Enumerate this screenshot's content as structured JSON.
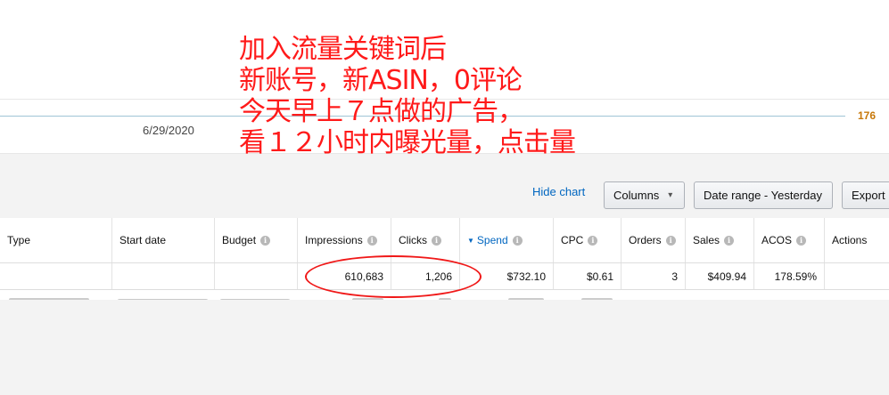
{
  "annotation": {
    "lines": [
      "加入流量关键词后",
      "新账号，新ASIN，0评论",
      "今天早上７点做的广告，",
      "看１２小时内曝光量，点击量"
    ],
    "color": "#ff1a1a"
  },
  "chart": {
    "date_label": "6/29/2020",
    "max_label": "176"
  },
  "toolbar": {
    "hide_chart": "Hide chart",
    "columns": "Columns",
    "date_range": "Date range - Yesterday",
    "export": "Export"
  },
  "table": {
    "headers": {
      "type": "Type",
      "start_date": "Start date",
      "budget": "Budget",
      "impressions": "Impressions",
      "clicks": "Clicks",
      "spend": "Spend",
      "cpc": "CPC",
      "orders": "Orders",
      "sales": "Sales",
      "acos": "ACOS",
      "actions": "Actions"
    },
    "totals": {
      "impressions": "610,683",
      "clicks": "1,206",
      "spend": "$732.10",
      "cpc": "$0.61",
      "orders": "3",
      "sales": "$409.94",
      "acos": "178.59%"
    }
  },
  "colors": {
    "link": "#0066c0",
    "accent_orange": "#c7780a",
    "annotation_red": "#ff1a1a"
  }
}
